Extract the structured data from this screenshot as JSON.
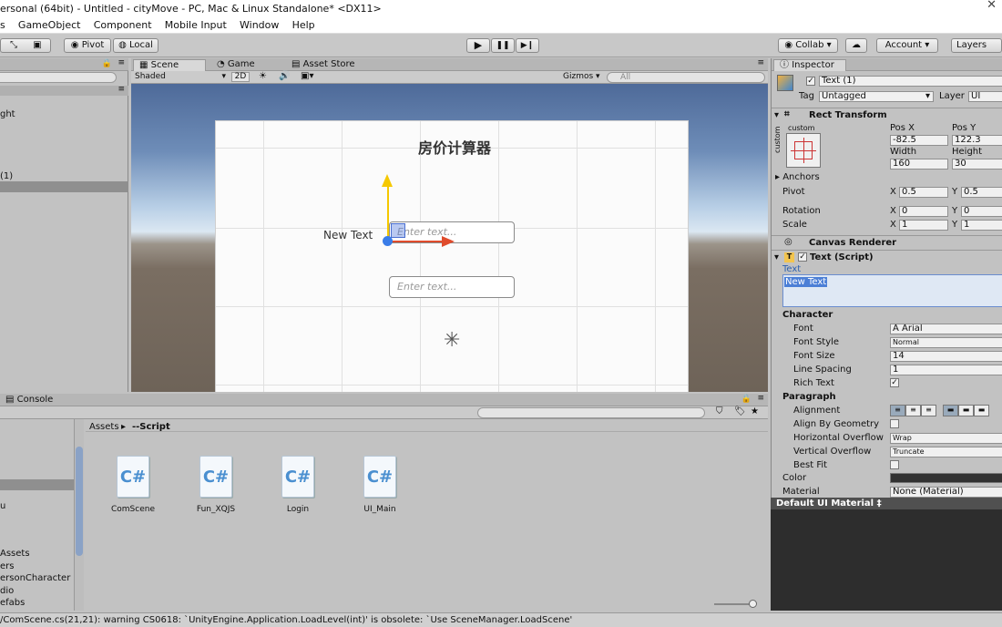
{
  "window": {
    "title": "ersonal (64bit) - Untitled - cityMove - PC, Mac & Linux Standalone* <DX11>"
  },
  "menu": [
    "s",
    "GameObject",
    "Component",
    "Mobile Input",
    "Window",
    "Help"
  ],
  "toolbar": {
    "pivot": "Pivot",
    "local": "Local",
    "collab": "Collab ▾",
    "account": "Account",
    "layers": "Layers",
    "play_icons": [
      "▶",
      "❚❚",
      "▶❙"
    ]
  },
  "scene_tabs": {
    "scene": "Scene",
    "game": "Game",
    "asset_store": "Asset Store"
  },
  "scene_toolbar": {
    "shading": "Shaded",
    "mode_2d": "2D",
    "gizmos": "Gizmos ▾",
    "search_placeholder": "All"
  },
  "hierarchy": {
    "items": [
      "ght",
      "(1)"
    ]
  },
  "canvas": {
    "title": "房价计算器",
    "label": "New Text",
    "input1_placeholder": "Enter text...",
    "input2_placeholder": "Enter text..."
  },
  "inspector": {
    "tab": "Inspector",
    "object_name": "Text (1)",
    "tag_label": "Tag",
    "tag_value": "Untagged",
    "layer_label": "Layer",
    "layer_value": "UI",
    "rect": {
      "header": "Rect Transform",
      "custom_top": "custom",
      "custom_side": "custom",
      "posx_label": "Pos X",
      "posy_label": "Pos Y",
      "posx": "-82.5",
      "posy": "122.3",
      "width_label": "Width",
      "height_label": "Height",
      "width": "160",
      "height": "30",
      "anchors": "Anchors",
      "pivot": "Pivot",
      "pivot_x": "0.5",
      "pivot_y": "0.5",
      "rotation": "Rotation",
      "rot_x": "0",
      "rot_y": "0",
      "scale": "Scale",
      "scale_x": "1",
      "scale_y": "1",
      "x": "X",
      "y": "Y"
    },
    "canvas_renderer": "Canvas Renderer",
    "text_script": {
      "header": "Text (Script)",
      "text_label": "Text",
      "text_value": "New Text",
      "character": "Character",
      "font_label": "Font",
      "font_value": "Arial",
      "style_label": "Font Style",
      "style_value": "Normal",
      "size_label": "Font Size",
      "size_value": "14",
      "spacing_label": "Line Spacing",
      "spacing_value": "1",
      "rich_label": "Rich Text",
      "paragraph": "Paragraph",
      "alignment_label": "Alignment",
      "align_geom_label": "Align By Geometry",
      "h_overflow_label": "Horizontal Overflow",
      "h_overflow_value": "Wrap",
      "v_overflow_label": "Vertical Overflow",
      "v_overflow_value": "Truncate",
      "best_fit_label": "Best Fit",
      "color_label": "Color",
      "material_label": "Material",
      "material_value": "None (Material)"
    },
    "preview_title": "Default UI Material ‡"
  },
  "console_tab": "Console",
  "project": {
    "breadcrumb_root": "Assets",
    "breadcrumb_sep": "▸",
    "breadcrumb_current": "--Script",
    "tree": [
      "u",
      "Assets",
      "ers",
      "ersonCharacter",
      "dio",
      "efabs"
    ],
    "files": [
      "ComScene",
      "Fun_XQJS",
      "Login",
      "UI_Main"
    ],
    "file_icon": "C#"
  },
  "status": {
    "message": "/ComScene.cs(21,21): warning CS0618: `UnityEngine.Application.LoadLevel(int)' is obsolete: `Use SceneManager.LoadScene'"
  }
}
